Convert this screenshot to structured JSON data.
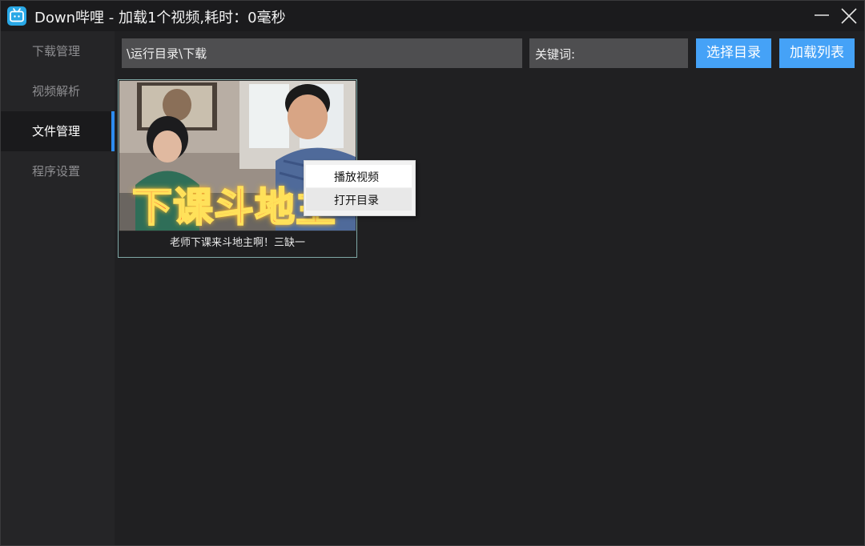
{
  "window": {
    "title": "Down哔哩 - 加载1个视频,耗时：0毫秒",
    "icons": {
      "app": "bilibili-tv-icon",
      "minimize": "minimize-icon",
      "close": "close-icon"
    }
  },
  "sidebar": {
    "items": [
      {
        "label": "下载管理",
        "active": false
      },
      {
        "label": "视频解析",
        "active": false
      },
      {
        "label": "文件管理",
        "active": true
      },
      {
        "label": "程序设置",
        "active": false
      }
    ]
  },
  "toolbar": {
    "path_value": "\\运行目录\\下载",
    "keyword_label": "关键词:",
    "keyword_value": "",
    "select_dir_label": "选择目录",
    "load_list_label": "加载列表"
  },
  "videos": [
    {
      "thumbnail_caption": "下课斗地主",
      "title": "老师下课来斗地主啊！三缺一"
    }
  ],
  "context_menu": {
    "items": [
      {
        "label": "播放视频"
      },
      {
        "label": "打开目录"
      }
    ]
  },
  "colors": {
    "accent": "#45a2f7",
    "active_indicator": "#2d8cf0",
    "background": "#202022",
    "sidebar": "#252527"
  }
}
